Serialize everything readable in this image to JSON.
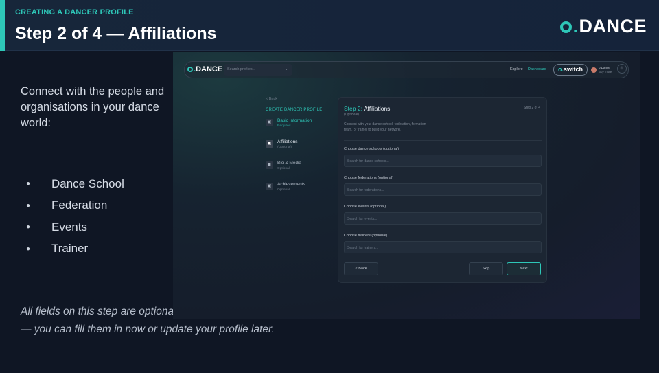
{
  "header": {
    "kicker": "CREATING A DANCER PROFILE",
    "title": "Step 2 of 4 — Affiliations",
    "logo_text": "DANCE"
  },
  "left": {
    "intro": "Connect with the people and organisations in your dance world:",
    "bullets": [
      "Dance School",
      "Federation",
      "Events",
      "Trainer"
    ],
    "note_line1": "All fields on this step are optional",
    "note_line2": "— you can fill them in now or update your profile later."
  },
  "app": {
    "topbar": {
      "logo_text": "DANCE",
      "search_placeholder": "Search profiles...",
      "explore": "Explore",
      "dashboard": "Dashboard",
      "switch_label": "switch",
      "user_name": "0.Dance",
      "user_sub": "Buy more"
    },
    "sidebar": {
      "back": "< Back",
      "heading": "CREATE DANCER PROFILE",
      "steps": [
        {
          "label": "Basic Information",
          "sub": "Required"
        },
        {
          "label": "Affiliations",
          "sub": "(Optional)"
        },
        {
          "label": "Bio & Media",
          "sub": "Optional"
        },
        {
          "label": "Achievements",
          "sub": "Optional"
        }
      ]
    },
    "card": {
      "title_prefix": "Step 2:",
      "title": "Affiliations",
      "optional": "(Optional)",
      "step_counter": "Step 2 of 4",
      "description": "Connect with your dance school, federation, formation team, or trainer to build your network.",
      "fields": [
        {
          "label": "Choose dance schools (optional)",
          "placeholder": "Search for dance schools..."
        },
        {
          "label": "Choose federations (optional)",
          "placeholder": "Search for federations..."
        },
        {
          "label": "Choose events (optional)",
          "placeholder": "Search for events..."
        },
        {
          "label": "Choose trainers (optional)",
          "placeholder": "Search for trainers..."
        }
      ],
      "back_button": "< Back",
      "skip_button": "Skip",
      "next_button": "Next"
    }
  },
  "colors": {
    "accent": "#2ec7b8",
    "background": "#0f1624",
    "header_bg": "#17263a"
  }
}
